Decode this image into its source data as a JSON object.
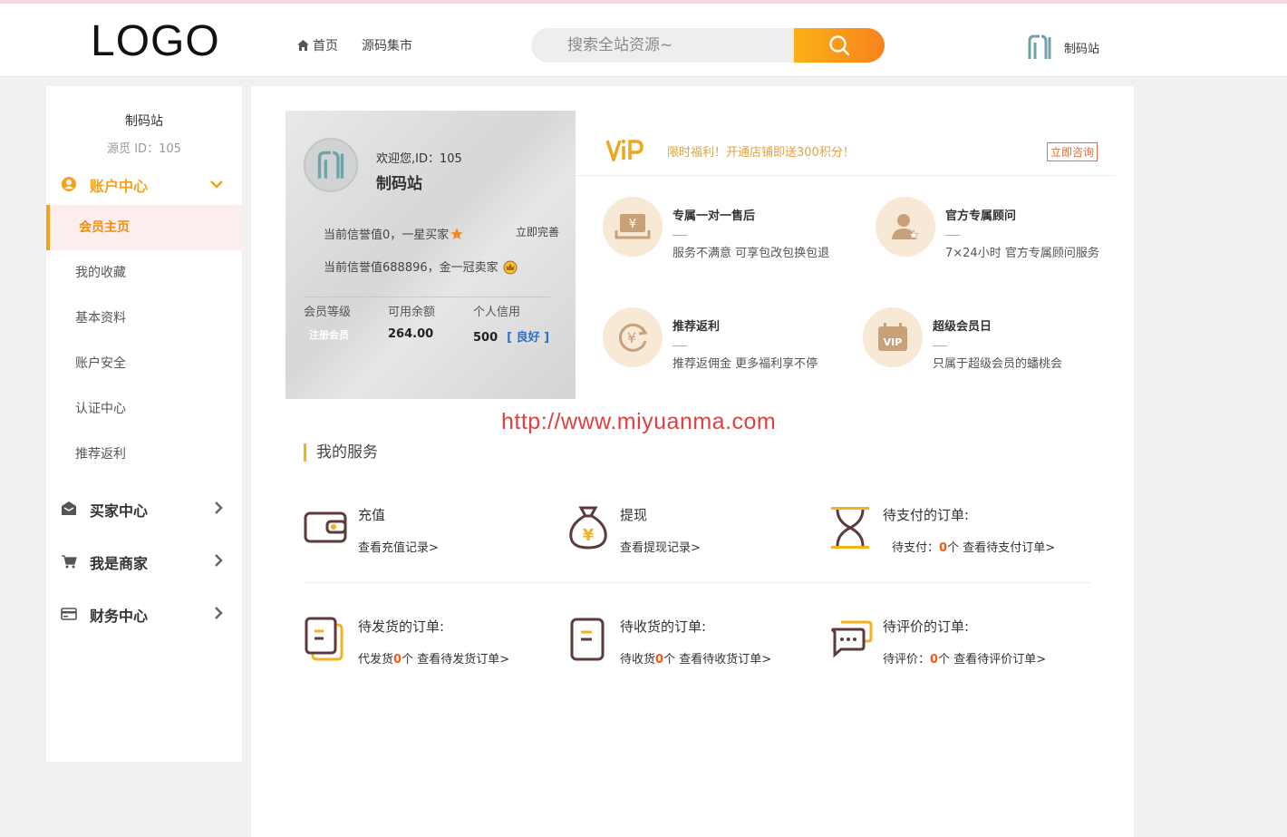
{
  "header": {
    "logo": "LOGO",
    "nav": [
      {
        "label": "首页",
        "icon": "home-icon"
      },
      {
        "label": "源码集市"
      }
    ],
    "search_placeholder": "搜索全站资源~",
    "username": "制码站"
  },
  "sidebar": {
    "name": "制码站",
    "id_text": "源觅 ID：105",
    "account_center": "账户中心",
    "sub_items": [
      "会员主页",
      "我的收藏",
      "基本资料",
      "账户安全",
      "认证中心",
      "推荐返利"
    ],
    "buyer_center": "买家中心",
    "merchant": "我是商家",
    "finance": "财务中心"
  },
  "card": {
    "welcome": "欢迎您,ID：105",
    "name": "制码站",
    "buyer_credit": "当前信誉值0，一星买家",
    "perfect_link": "立即完善",
    "seller_credit": "当前信誉值688896，金一冠卖家",
    "cols": [
      "会员等级",
      "可用余额",
      "个人信用"
    ],
    "level": "注册会员",
    "balance": "264.00",
    "credit_score": "500",
    "credit_status": "[ 良好 ]"
  },
  "vip": {
    "logo": "VIP",
    "promo": "限时福利！开通店铺即送300积分！",
    "consult": "立即咨询"
  },
  "perks": [
    {
      "title": "专属一对一售后",
      "desc": "服务不满意 可享包改包换包退",
      "icon": "yuan-box-icon"
    },
    {
      "title": "官方专属顾问",
      "desc": "7×24小时 官方专属顾问服务",
      "icon": "advisor-icon"
    },
    {
      "title": "推荐返利",
      "desc": "推荐返佣金 更多福利享不停",
      "icon": "yuan-refresh-icon"
    },
    {
      "title": "超级会员日",
      "desc": "只属于超级会员的蟠桃会",
      "icon": "vip-calendar-icon"
    }
  ],
  "watermark": "http://www.miyuanma.com",
  "services_title": "我的服务",
  "services": [
    {
      "title": "充值",
      "pre": "查看充值记录>",
      "num": "",
      "post": "",
      "icon": "wallet-icon"
    },
    {
      "title": "提现",
      "pre": "查看提现记录>",
      "num": "",
      "post": "",
      "icon": "money-bag-icon"
    },
    {
      "title": "待支付的订单:",
      "pre": "待支付：",
      "num": "0",
      "post": "个 查看待支付订单>",
      "icon": "hourglass-icon"
    },
    {
      "title": "待发货的订单:",
      "pre": "代发货",
      "num": "0",
      "post": "个 查看待发货订单>",
      "icon": "ship-doc-icon"
    },
    {
      "title": "待收货的订单:",
      "pre": "待收货",
      "num": "0",
      "post": "个 查看待收货订单>",
      "icon": "receive-doc-icon"
    },
    {
      "title": "待评价的订单:",
      "pre": "待评价：",
      "num": "0",
      "post": "个 查看待评价订单>",
      "icon": "comment-icon"
    }
  ],
  "colors": {
    "accent": "#f5a11c",
    "orange_button": "#f8821d",
    "number": "#f25b1b",
    "credit_good": "#2d6ec9"
  }
}
